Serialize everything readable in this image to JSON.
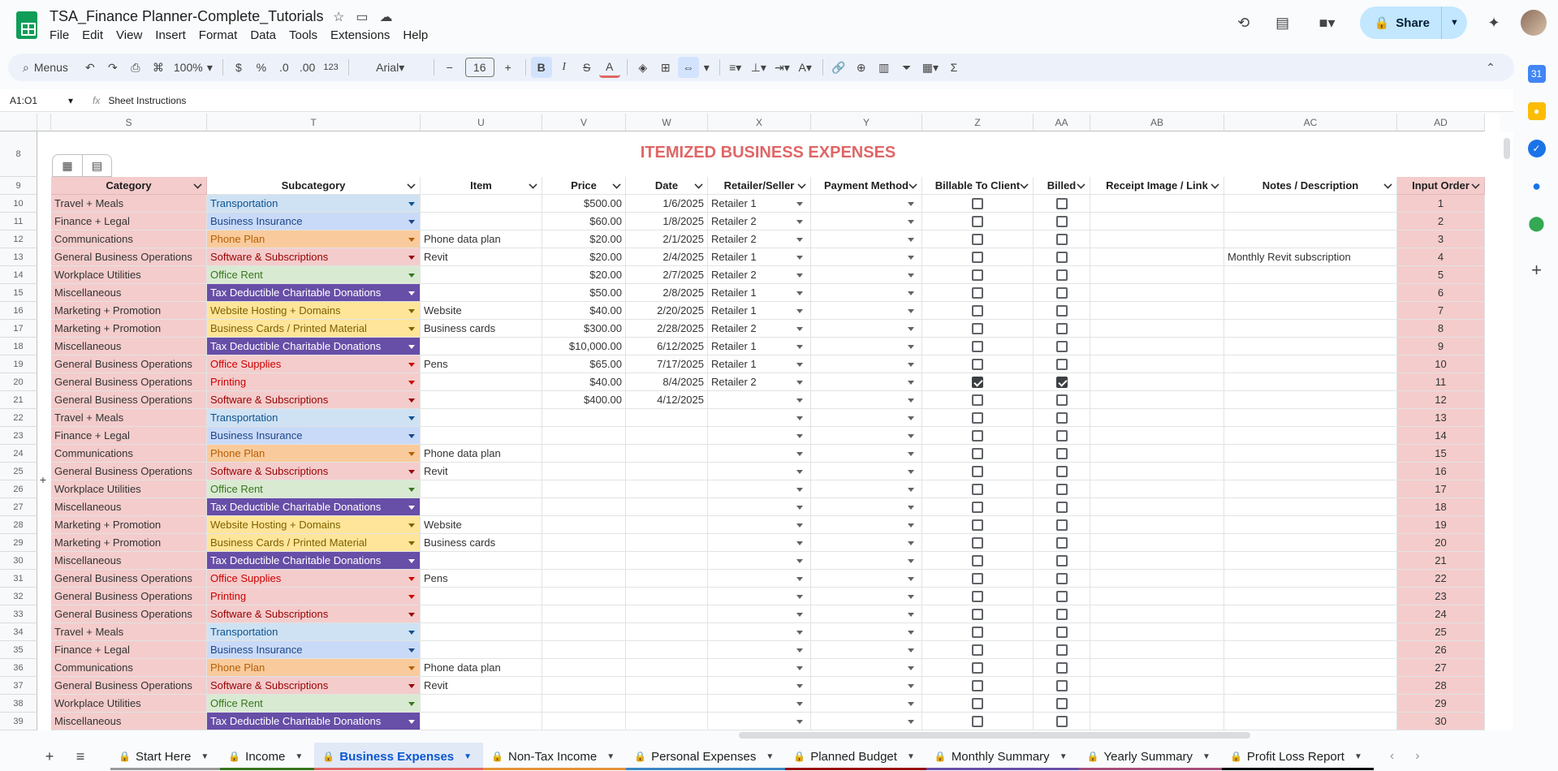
{
  "doc": {
    "title": "TSA_Finance Planner-Complete_Tutorials",
    "menu": [
      "File",
      "Edit",
      "View",
      "Insert",
      "Format",
      "Data",
      "Tools",
      "Extensions",
      "Help"
    ],
    "share_label": "Share"
  },
  "toolbar": {
    "search_label": "Menus",
    "zoom": "100%",
    "currency": "$",
    "percent": "%",
    "dec_decrease": ".0",
    "dec_increase": ".00",
    "number_format": "123",
    "font": "Arial",
    "font_size": "16"
  },
  "formula_bar": {
    "name_box": "A1:O1",
    "fx": "fx",
    "content": "Sheet Instructions"
  },
  "columns": [
    "S",
    "T",
    "U",
    "V",
    "W",
    "X",
    "Y",
    "Z",
    "AA",
    "AB",
    "AC",
    "AD"
  ],
  "sheet_title": "ITEMIZED BUSINESS EXPENSES",
  "headers": [
    "Category",
    "Subcategory",
    "Item",
    "Price",
    "Date",
    "Retailer/Seller",
    "Payment Method",
    "Billable To Client",
    "Billed",
    "Receipt Image / Link",
    "Notes / Description",
    "Input Order"
  ],
  "title_row_number": "8",
  "header_row_number": "9",
  "subcategory_colors": {
    "Transportation": {
      "bg": "#cfe2f3",
      "fg": "#0b5394"
    },
    "Business Insurance": {
      "bg": "#c9daf8",
      "fg": "#1c4587"
    },
    "Phone Plan": {
      "bg": "#f9cb9c",
      "fg": "#b45f06"
    },
    "Software & Subscriptions": {
      "bg": "#f4cccc",
      "fg": "#990000"
    },
    "Office Rent": {
      "bg": "#d9ead3",
      "fg": "#38761d"
    },
    "Tax Deductible Charitable Donations": {
      "bg": "#674ea7",
      "fg": "#ffffff"
    },
    "Website Hosting + Domains": {
      "bg": "#ffe599",
      "fg": "#7f6000"
    },
    "Business Cards / Printed Material": {
      "bg": "#ffe599",
      "fg": "#7f6000"
    },
    "Office Supplies": {
      "bg": "#f4cccc",
      "fg": "#cc0000"
    },
    "Printing": {
      "bg": "#f4cccc",
      "fg": "#cc0000"
    }
  },
  "rows": [
    {
      "n": "10",
      "category": "Travel + Meals",
      "subcategory": "Transportation",
      "item": "",
      "price": "$500.00",
      "date": "1/6/2025",
      "retailer": "Retailer 1",
      "billable": false,
      "billed": false,
      "notes": "",
      "order": "1"
    },
    {
      "n": "11",
      "category": "Finance + Legal",
      "subcategory": "Business Insurance",
      "item": "",
      "price": "$60.00",
      "date": "1/8/2025",
      "retailer": "Retailer 2",
      "billable": false,
      "billed": false,
      "notes": "",
      "order": "2"
    },
    {
      "n": "12",
      "category": "Communications",
      "subcategory": "Phone Plan",
      "item": "Phone data plan",
      "price": "$20.00",
      "date": "2/1/2025",
      "retailer": "Retailer 2",
      "billable": false,
      "billed": false,
      "notes": "",
      "order": "3"
    },
    {
      "n": "13",
      "category": "General Business Operations",
      "subcategory": "Software & Subscriptions",
      "item": "Revit",
      "price": "$20.00",
      "date": "2/4/2025",
      "retailer": "Retailer 1",
      "billable": false,
      "billed": false,
      "notes": "Monthly Revit subscription",
      "order": "4"
    },
    {
      "n": "14",
      "category": "Workplace Utilities",
      "subcategory": "Office Rent",
      "item": "",
      "price": "$20.00",
      "date": "2/7/2025",
      "retailer": "Retailer 2",
      "billable": false,
      "billed": false,
      "notes": "",
      "order": "5"
    },
    {
      "n": "15",
      "category": "Miscellaneous",
      "subcategory": "Tax Deductible Charitable Donations",
      "item": "",
      "price": "$50.00",
      "date": "2/8/2025",
      "retailer": "Retailer 1",
      "billable": false,
      "billed": false,
      "notes": "",
      "order": "6"
    },
    {
      "n": "16",
      "category": "Marketing + Promotion",
      "subcategory": "Website Hosting + Domains",
      "item": "Website",
      "price": "$40.00",
      "date": "2/20/2025",
      "retailer": "Retailer 1",
      "billable": false,
      "billed": false,
      "notes": "",
      "order": "7"
    },
    {
      "n": "17",
      "category": "Marketing + Promotion",
      "subcategory": "Business Cards / Printed Material",
      "item": "Business cards",
      "price": "$300.00",
      "date": "2/28/2025",
      "retailer": "Retailer 2",
      "billable": false,
      "billed": false,
      "notes": "",
      "order": "8"
    },
    {
      "n": "18",
      "category": "Miscellaneous",
      "subcategory": "Tax Deductible Charitable Donations",
      "item": "",
      "price": "$10,000.00",
      "date": "6/12/2025",
      "retailer": "Retailer 1",
      "billable": false,
      "billed": false,
      "notes": "",
      "order": "9"
    },
    {
      "n": "19",
      "category": "General Business Operations",
      "subcategory": "Office Supplies",
      "item": "Pens",
      "price": "$65.00",
      "date": "7/17/2025",
      "retailer": "Retailer 1",
      "billable": false,
      "billed": false,
      "notes": "",
      "order": "10"
    },
    {
      "n": "20",
      "category": "General Business Operations",
      "subcategory": "Printing",
      "item": "",
      "price": "$40.00",
      "date": "8/4/2025",
      "retailer": "Retailer 2",
      "billable": true,
      "billed": true,
      "notes": "",
      "order": "11"
    },
    {
      "n": "21",
      "category": "General Business Operations",
      "subcategory": "Software & Subscriptions",
      "item": "",
      "price": "$400.00",
      "date": "4/12/2025",
      "retailer": "",
      "billable": false,
      "billed": false,
      "notes": "",
      "order": "12"
    },
    {
      "n": "22",
      "category": "Travel + Meals",
      "subcategory": "Transportation",
      "item": "",
      "price": "",
      "date": "",
      "retailer": "",
      "billable": false,
      "billed": false,
      "notes": "",
      "order": "13"
    },
    {
      "n": "23",
      "category": "Finance + Legal",
      "subcategory": "Business Insurance",
      "item": "",
      "price": "",
      "date": "",
      "retailer": "",
      "billable": false,
      "billed": false,
      "notes": "",
      "order": "14"
    },
    {
      "n": "24",
      "category": "Communications",
      "subcategory": "Phone Plan",
      "item": "Phone data plan",
      "price": "",
      "date": "",
      "retailer": "",
      "billable": false,
      "billed": false,
      "notes": "",
      "order": "15"
    },
    {
      "n": "25",
      "category": "General Business Operations",
      "subcategory": "Software & Subscriptions",
      "item": "Revit",
      "price": "",
      "date": "",
      "retailer": "",
      "billable": false,
      "billed": false,
      "notes": "",
      "order": "16"
    },
    {
      "n": "26",
      "category": "Workplace Utilities",
      "subcategory": "Office Rent",
      "item": "",
      "price": "",
      "date": "",
      "retailer": "",
      "billable": false,
      "billed": false,
      "notes": "",
      "order": "17"
    },
    {
      "n": "27",
      "category": "Miscellaneous",
      "subcategory": "Tax Deductible Charitable Donations",
      "item": "",
      "price": "",
      "date": "",
      "retailer": "",
      "billable": false,
      "billed": false,
      "notes": "",
      "order": "18"
    },
    {
      "n": "28",
      "category": "Marketing + Promotion",
      "subcategory": "Website Hosting + Domains",
      "item": "Website",
      "price": "",
      "date": "",
      "retailer": "",
      "billable": false,
      "billed": false,
      "notes": "",
      "order": "19"
    },
    {
      "n": "29",
      "category": "Marketing + Promotion",
      "subcategory": "Business Cards / Printed Material",
      "item": "Business cards",
      "price": "",
      "date": "",
      "retailer": "",
      "billable": false,
      "billed": false,
      "notes": "",
      "order": "20"
    },
    {
      "n": "30",
      "category": "Miscellaneous",
      "subcategory": "Tax Deductible Charitable Donations",
      "item": "",
      "price": "",
      "date": "",
      "retailer": "",
      "billable": false,
      "billed": false,
      "notes": "",
      "order": "21"
    },
    {
      "n": "31",
      "category": "General Business Operations",
      "subcategory": "Office Supplies",
      "item": "Pens",
      "price": "",
      "date": "",
      "retailer": "",
      "billable": false,
      "billed": false,
      "notes": "",
      "order": "22"
    },
    {
      "n": "32",
      "category": "General Business Operations",
      "subcategory": "Printing",
      "item": "",
      "price": "",
      "date": "",
      "retailer": "",
      "billable": false,
      "billed": false,
      "notes": "",
      "order": "23"
    },
    {
      "n": "33",
      "category": "General Business Operations",
      "subcategory": "Software & Subscriptions",
      "item": "",
      "price": "",
      "date": "",
      "retailer": "",
      "billable": false,
      "billed": false,
      "notes": "",
      "order": "24"
    },
    {
      "n": "34",
      "category": "Travel + Meals",
      "subcategory": "Transportation",
      "item": "",
      "price": "",
      "date": "",
      "retailer": "",
      "billable": false,
      "billed": false,
      "notes": "",
      "order": "25"
    },
    {
      "n": "35",
      "category": "Finance + Legal",
      "subcategory": "Business Insurance",
      "item": "",
      "price": "",
      "date": "",
      "retailer": "",
      "billable": false,
      "billed": false,
      "notes": "",
      "order": "26"
    },
    {
      "n": "36",
      "category": "Communications",
      "subcategory": "Phone Plan",
      "item": "Phone data plan",
      "price": "",
      "date": "",
      "retailer": "",
      "billable": false,
      "billed": false,
      "notes": "",
      "order": "27"
    },
    {
      "n": "37",
      "category": "General Business Operations",
      "subcategory": "Software & Subscriptions",
      "item": "Revit",
      "price": "",
      "date": "",
      "retailer": "",
      "billable": false,
      "billed": false,
      "notes": "",
      "order": "28"
    },
    {
      "n": "38",
      "category": "Workplace Utilities",
      "subcategory": "Office Rent",
      "item": "",
      "price": "",
      "date": "",
      "retailer": "",
      "billable": false,
      "billed": false,
      "notes": "",
      "order": "29"
    },
    {
      "n": "39",
      "category": "Miscellaneous",
      "subcategory": "Tax Deductible Charitable Donations",
      "item": "",
      "price": "",
      "date": "",
      "retailer": "",
      "billable": false,
      "billed": false,
      "notes": "",
      "order": "30"
    }
  ],
  "tabs": [
    {
      "label": "Start Here",
      "color": "#999999",
      "active": false
    },
    {
      "label": "Income",
      "color": "#38761d",
      "active": false
    },
    {
      "label": "Business Expenses",
      "color": "#e06666",
      "active": true
    },
    {
      "label": "Non-Tax Income",
      "color": "#e69138",
      "active": false
    },
    {
      "label": "Personal Expenses",
      "color": "#3d85c6",
      "active": false
    },
    {
      "label": "Planned Budget",
      "color": "#990000",
      "active": false
    },
    {
      "label": "Monthly Summary",
      "color": "#674ea7",
      "active": false
    },
    {
      "label": "Yearly Summary",
      "color": "#a64d79",
      "active": false
    },
    {
      "label": "Profit Loss Report",
      "color": "#000000",
      "active": false
    }
  ]
}
